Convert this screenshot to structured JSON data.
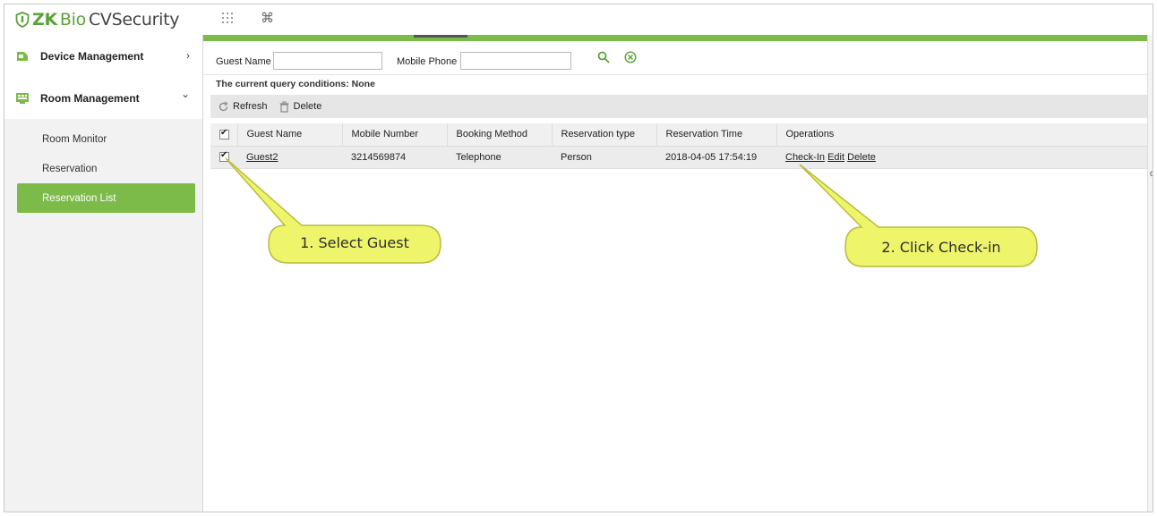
{
  "app": {
    "logo_zk": "ZK",
    "logo_bio": "Bio",
    "logo_rest": " CVSecurity",
    "grid_icon": "grid-dots-icon",
    "command_icon": "command-icon"
  },
  "sidebar": {
    "groups": [
      {
        "label": "Device Management",
        "icon": "device-management-icon",
        "chevron": "›"
      },
      {
        "label": "Room Management",
        "icon": "room-management-icon",
        "chevron": "⌄"
      }
    ],
    "items": [
      {
        "label": "Room Monitor"
      },
      {
        "label": "Reservation"
      },
      {
        "label": "Reservation List"
      }
    ]
  },
  "search": {
    "guest_name_label": "Guest Name",
    "guest_name_value": "",
    "mobile_phone_label": "Mobile Phone",
    "mobile_phone_value": "",
    "conditions_text": "The current query conditions: None"
  },
  "toolbar": {
    "refresh_label": "Refresh",
    "delete_label": "Delete"
  },
  "table": {
    "columns": [
      "Guest Name",
      "Mobile Number",
      "Booking Method",
      "Reservation type",
      "Reservation Time",
      "Operations"
    ],
    "rows": [
      {
        "checked": true,
        "guest_name": "Guest2",
        "mobile_number": "3214569874",
        "booking_method": "Telephone",
        "reservation_type": "Person",
        "reservation_time": "2018-04-05 17:54:19",
        "op_checkin": "Check-In",
        "op_edit": "Edit",
        "op_delete": "Delete"
      }
    ]
  },
  "right_edge_char": "d",
  "callouts": {
    "first": "1. Select Guest",
    "second": "2. Click Check-in",
    "color": "#eef56a"
  },
  "colors": {
    "accent_green": "#7cbb49",
    "logo_green": "#5aa339"
  }
}
